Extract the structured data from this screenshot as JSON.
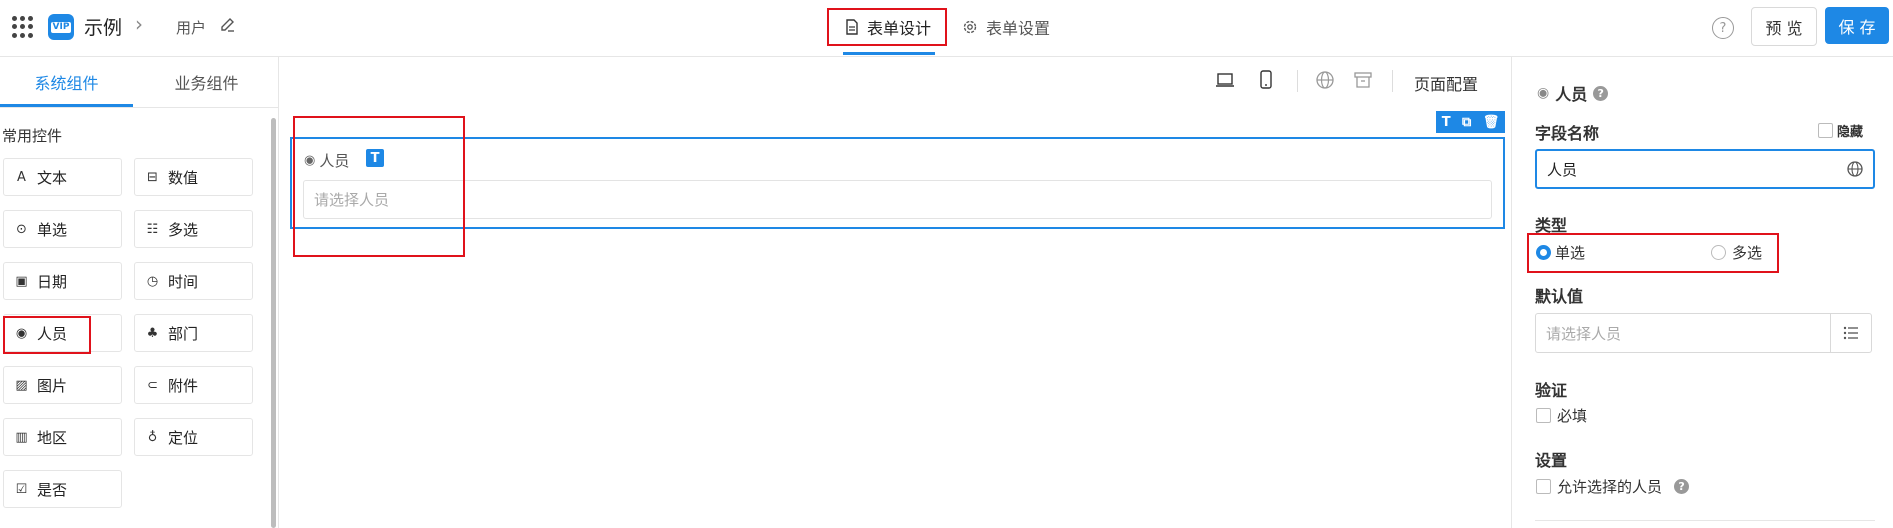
{
  "header": {
    "app_title": "示例",
    "breadcrumb": "用户",
    "tabs": [
      {
        "label": "表单设计",
        "active": true
      },
      {
        "label": "表单设置",
        "active": false
      }
    ],
    "preview_label": "预 览",
    "save_label": "保 存"
  },
  "left_panel": {
    "tabs": [
      {
        "label": "系统组件",
        "active": true
      },
      {
        "label": "业务组件",
        "active": false
      }
    ],
    "group_title": "常用控件",
    "components": [
      {
        "label": "文本",
        "icon": "text-icon"
      },
      {
        "label": "数值",
        "icon": "number-icon"
      },
      {
        "label": "单选",
        "icon": "single-select-icon"
      },
      {
        "label": "多选",
        "icon": "multi-select-icon"
      },
      {
        "label": "日期",
        "icon": "calendar-icon"
      },
      {
        "label": "时间",
        "icon": "clock-icon"
      },
      {
        "label": "人员",
        "icon": "person-icon"
      },
      {
        "label": "部门",
        "icon": "org-icon"
      },
      {
        "label": "图片",
        "icon": "image-icon"
      },
      {
        "label": "附件",
        "icon": "attachment-icon"
      },
      {
        "label": "地区",
        "icon": "map-icon"
      },
      {
        "label": "定位",
        "icon": "location-icon"
      },
      {
        "label": "是否",
        "icon": "checkbox-icon"
      }
    ]
  },
  "canvas": {
    "page_config_label": "页面配置",
    "field": {
      "label": "人员",
      "badge": "T",
      "placeholder": "请选择人员"
    }
  },
  "right_panel": {
    "title": "人员",
    "field_name_label": "字段名称",
    "hide_label": "隐藏",
    "field_name_value": "人员",
    "type_label": "类型",
    "type_options": [
      {
        "label": "单选",
        "selected": true
      },
      {
        "label": "多选",
        "selected": false
      }
    ],
    "default_label": "默认值",
    "default_placeholder": "请选择人员",
    "validation_label": "验证",
    "required_label": "必填",
    "settings_label": "设置",
    "allow_select_label": "允许选择的人员"
  },
  "colors": {
    "accent": "#1e88e5",
    "annotation": "#e0121b"
  }
}
